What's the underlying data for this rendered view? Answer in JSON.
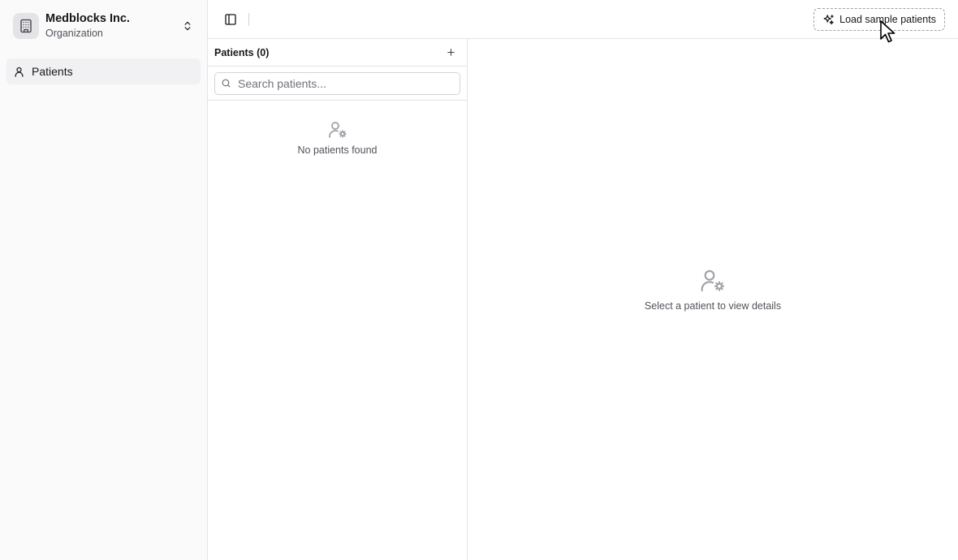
{
  "org": {
    "name": "Medblocks Inc.",
    "subtitle": "Organization",
    "logo_icon": "building-icon",
    "switch_icon": "chevrons-up-down-icon"
  },
  "sidebar": {
    "items": [
      {
        "label": "Patients",
        "icon": "user-icon",
        "active": true
      }
    ]
  },
  "topbar": {
    "toggle_icon": "panel-left-icon",
    "load_button": {
      "label": "Load sample patients",
      "icon": "sparkles-icon"
    }
  },
  "patients_list": {
    "title": "Patients (0)",
    "add_icon": "plus-icon",
    "search": {
      "placeholder": "Search patients...",
      "value": "",
      "icon": "search-icon"
    },
    "empty_text": "No patients found",
    "empty_icon": "user-cog-icon"
  },
  "detail": {
    "empty_text": "Select a patient to view details",
    "empty_icon": "user-cog-icon"
  },
  "colors": {
    "sidebar_bg": "#fafafa",
    "border": "#e4e4e7",
    "muted_text": "#52525b",
    "icon_muted": "#a1a1aa"
  }
}
